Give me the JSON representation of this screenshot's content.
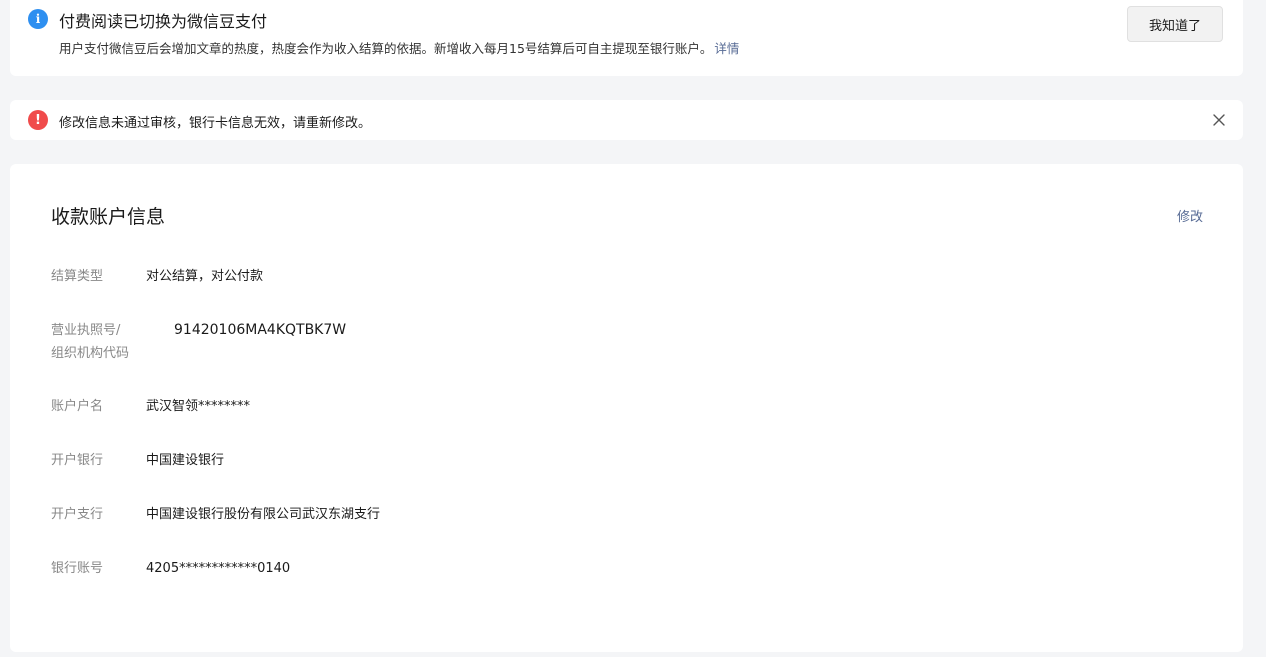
{
  "notice": {
    "icon": "info-icon",
    "title": "付费阅读已切换为微信豆支付",
    "description": "用户支付微信豆后会增加文章的热度，热度会作为收入结算的依据。新增收入每月15号结算后可自主提现至银行账户。",
    "link": "详情",
    "button": "我知道了"
  },
  "error": {
    "icon": "error-icon",
    "message": "修改信息未通过审核，银行卡信息无效，请重新修改。",
    "close_icon": "close-icon"
  },
  "account": {
    "title": "收款账户信息",
    "edit": "修改",
    "fields": [
      {
        "label": "结算类型",
        "value": "对公结算，对公付款"
      },
      {
        "label": "营业执照号/\n组织机构代码",
        "value": "91420106MA4KQTBK7W"
      },
      {
        "label": "账户户名",
        "value": "武汉智领********"
      },
      {
        "label": "开户银行",
        "value": "中国建设银行"
      },
      {
        "label": "开户支行",
        "value": "中国建设银行股份有限公司武汉东湖支行"
      },
      {
        "label": "银行账号",
        "value": "4205************0140"
      }
    ]
  },
  "colors": {
    "info": "#2e8ff0",
    "error": "#f04b4b",
    "link": "#576b95",
    "background": "#f4f5f7"
  }
}
